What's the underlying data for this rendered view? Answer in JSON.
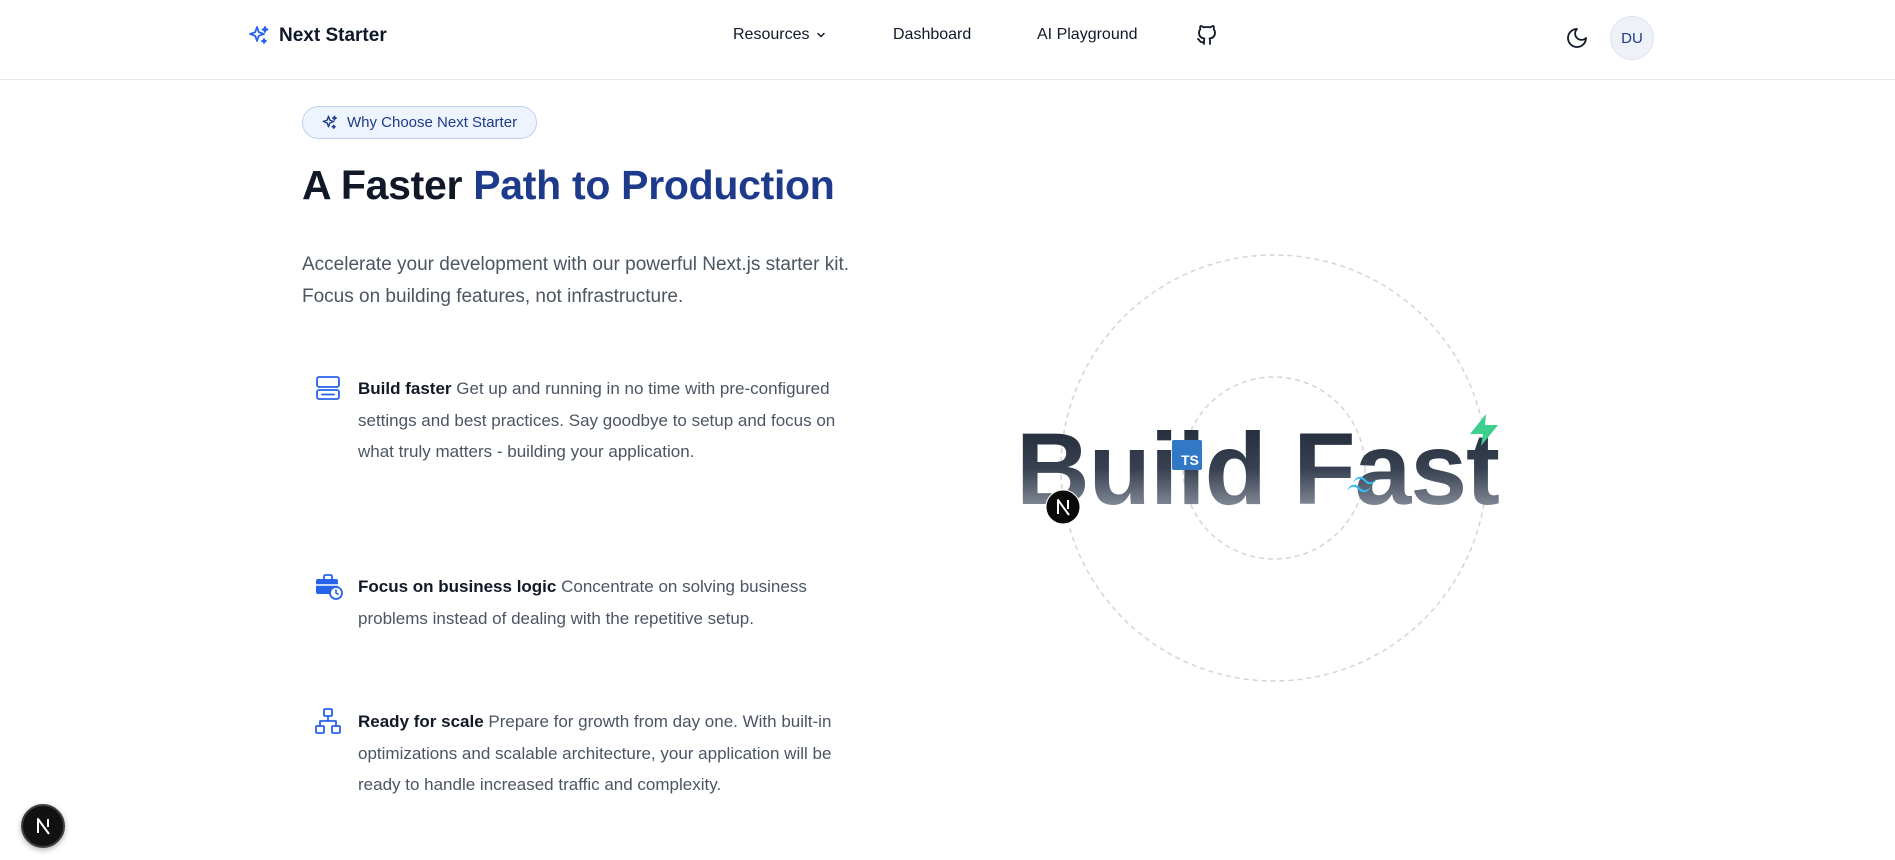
{
  "header": {
    "brand_name": "Next Starter",
    "nav": {
      "resources": "Resources",
      "dashboard": "Dashboard",
      "ai_playground": "AI Playground"
    },
    "avatar_initials": "DU"
  },
  "hero": {
    "badge": "Why Choose Next Starter",
    "title_plain": "A Faster ",
    "title_accent": "Path to Production",
    "subtitle": "Accelerate your development with our powerful Next.js starter kit. Focus on building features, not infrastructure."
  },
  "features": [
    {
      "icon": "server-icon",
      "title": "Build faster",
      "description": "Get up and running in no time with pre-configured settings and best practices. Say goodbye to setup and focus on what truly matters - building your application."
    },
    {
      "icon": "briefcase-clock-icon",
      "title": "Focus on business logic",
      "description": "Concentrate on solving business problems instead of dealing with the repetitive setup."
    },
    {
      "icon": "network-icon",
      "title": "Ready for scale",
      "description": "Prepare for growth from day one. With built-in optimizations and scalable architecture, your application will be ready to handle increased traffic and complexity."
    }
  ],
  "art": {
    "headline": "Build Fast",
    "ts_badge": "TS"
  },
  "colors": {
    "accent": "#1e3a8a",
    "icon_blue": "#2563eb",
    "supabase_green": "#3ecf8e",
    "tailwind_cyan": "#38bdf8",
    "typescript_blue": "#3178c6"
  }
}
